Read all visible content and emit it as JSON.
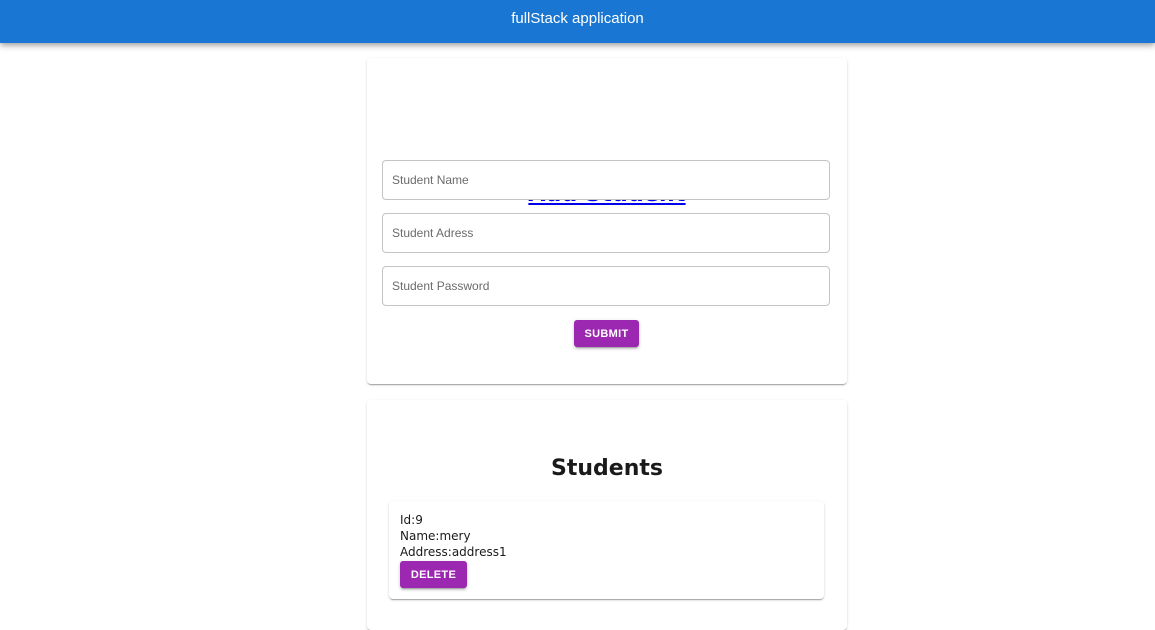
{
  "appbar": {
    "title": "fullStack application"
  },
  "form": {
    "heading": "Add Student",
    "fields": {
      "name_placeholder": "Student Name",
      "address_placeholder": "Student Adress",
      "password_placeholder": "Student Password"
    },
    "submit_label": "SUBMIT"
  },
  "students": {
    "heading": "Students",
    "items": [
      {
        "id_text": "Id:9",
        "name_text": "Name:mery",
        "address_text": "Address:address1",
        "delete_label": "DELETE"
      }
    ]
  },
  "colors": {
    "appbar": "#1976d2",
    "button": "#9c27b0",
    "link": "#0000ee"
  }
}
